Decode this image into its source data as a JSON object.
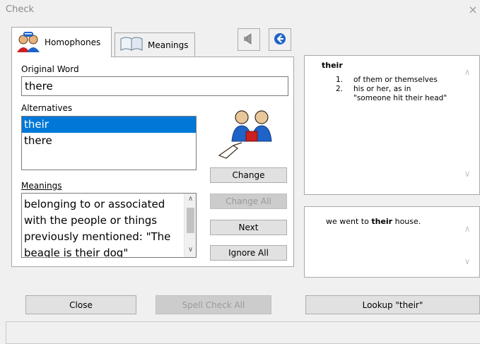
{
  "window": {
    "title": "Check",
    "close_glyph": "×"
  },
  "tabs": [
    {
      "label": "Homophones",
      "icon": "people-icon",
      "active": true
    },
    {
      "label": "Meanings",
      "icon": "book-icon",
      "active": false
    }
  ],
  "toolbar": {
    "speak_icon": "speaker-icon",
    "back_icon": "back-arrow-icon"
  },
  "original_word": {
    "label": "Original Word",
    "value": "there"
  },
  "alternatives": {
    "label": "Alternatives",
    "items": [
      "their",
      "there"
    ],
    "selected": 0
  },
  "meanings": {
    "label": "Meanings",
    "lines": [
      "belonging to or associated",
      "with the people or things",
      "previously mentioned: \"The",
      "beagle is their dog\""
    ]
  },
  "side_buttons": {
    "change": "Change",
    "change_all": "Change All",
    "next": "Next",
    "ignore_all": "Ignore All"
  },
  "definition": {
    "word": "their",
    "items": [
      {
        "num": "1.",
        "lines": [
          "of them or themselves"
        ]
      },
      {
        "num": "2.",
        "lines": [
          "his or her, as in",
          "\"someone hit their head\""
        ]
      }
    ]
  },
  "example": {
    "before": "we went to ",
    "bold": "their",
    "after": " house."
  },
  "bottom_buttons": {
    "close": "Close",
    "spell_check_all": "Spell Check All",
    "lookup": "Lookup \"their\""
  },
  "colors": {
    "selection": "#0078d7",
    "accent_blue": "#1e63c8",
    "icon_red": "#cc2020"
  }
}
